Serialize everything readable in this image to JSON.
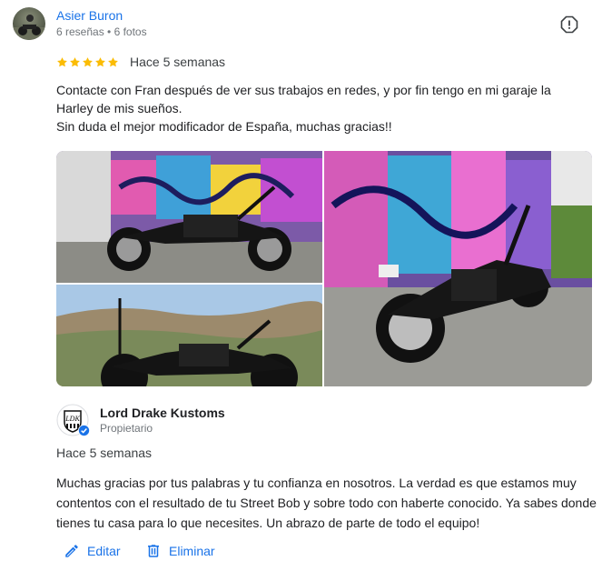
{
  "review": {
    "author_name": "Asier Buron",
    "author_stats": "6 reseñas • 6 fotos",
    "rating": 5,
    "time_ago": "Hace 5 semanas",
    "text": "Contacte con Fran después de ver sus trabajos en redes, y por fin tengo en mi garaje la Harley de mis sueños.\nSin duda el mejor modificador de España, muchas gracias!!"
  },
  "owner_reply": {
    "owner_name": "Lord Drake Kustoms",
    "owner_role": "Propietario",
    "time_ago": "Hace 5 semanas",
    "text": "Muchas gracias por tus palabras y tu confianza en nosotros. La verdad es que estamos muy contentos con el resultado de tu Street Bob y sobre todo con haberte conocido. Ya sabes donde tienes tu casa para lo que necesites. Un abrazo de parte de todo el equipo!"
  },
  "actions": {
    "edit_label": "Editar",
    "delete_label": "Eliminar"
  },
  "colors": {
    "accent": "#1a73e8",
    "star": "#fbbc04",
    "muted": "#70757a",
    "verified": "#1a73e8"
  },
  "icons": {
    "report": "report-flag-icon",
    "edit": "pencil-icon",
    "delete": "trash-icon",
    "verified": "verified-check-icon"
  }
}
